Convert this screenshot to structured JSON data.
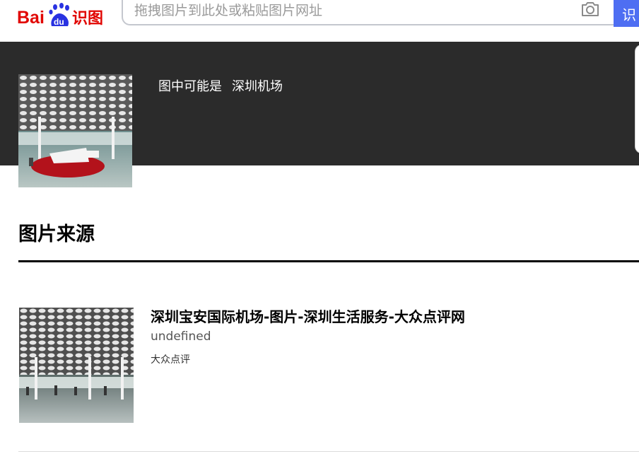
{
  "header": {
    "logo_text_bai": "Bai",
    "logo_text_du": "du",
    "logo_text_shitu": "识图",
    "search_placeholder": "拖拽图片到此处或粘贴图片网址",
    "search_button_label": "识"
  },
  "recognition": {
    "prefix": "图中可能是",
    "guess": "深圳机场"
  },
  "sources": {
    "title": "图片来源",
    "items": [
      {
        "title": "深圳宝安国际机场-图片-深圳生活服务-大众点评网",
        "description": "undefined",
        "site": "大众点评"
      }
    ]
  },
  "icons": {
    "logo": "baidu-paw-logo-icon",
    "camera": "camera-icon"
  },
  "colors": {
    "brand_red": "#e10602",
    "brand_blue": "#2932e1",
    "search_button": "#4e6ef2",
    "dark_band": "#2b2b2b"
  }
}
